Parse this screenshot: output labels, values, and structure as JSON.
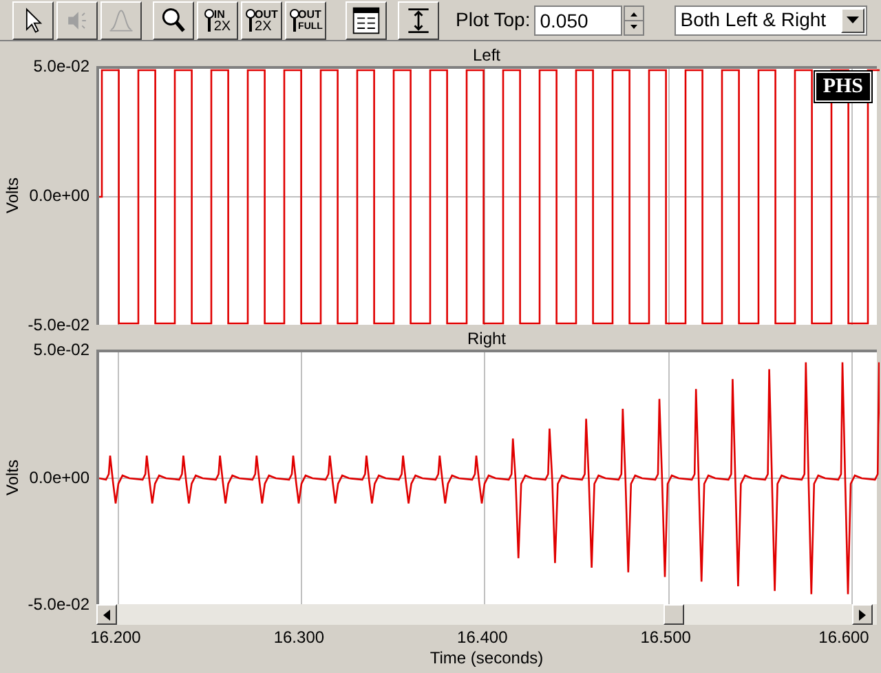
{
  "toolbar": {
    "groups": [
      {
        "buttons": [
          {
            "kind": "pointer",
            "disabled": false
          },
          {
            "kind": "speaker",
            "disabled": true
          },
          {
            "kind": "peak",
            "disabled": true
          }
        ]
      },
      {
        "buttons": [
          {
            "kind": "magnifier",
            "disabled": false
          },
          {
            "kind": "zoom",
            "top": "IN",
            "bottom": "2X",
            "disabled": false
          },
          {
            "kind": "zoom",
            "top": "OUT",
            "bottom": "2X",
            "disabled": false
          },
          {
            "kind": "zoom",
            "top": "OUT",
            "bottom": "FULL",
            "disabled": false
          }
        ]
      },
      {
        "buttons": [
          {
            "kind": "table",
            "disabled": false
          }
        ]
      },
      {
        "buttons": [
          {
            "kind": "fit",
            "disabled": false
          }
        ]
      }
    ],
    "plot_top": {
      "label": "Plot Top:",
      "value": "0.050"
    },
    "channel_select": {
      "value": "Both Left & Right"
    }
  },
  "plots": [
    {
      "title": "Left",
      "ylabel": "Volts",
      "yticks": [
        "5.0e-02",
        "0.0e+00",
        "-5.0e-02"
      ],
      "kind": "square",
      "badge": "PHS"
    },
    {
      "title": "Right",
      "ylabel": "Volts",
      "yticks": [
        "5.0e-02",
        "0.0e+00",
        "-5.0e-02"
      ],
      "kind": "spikes"
    }
  ],
  "x_axis": {
    "ticks": [
      "16.200",
      "16.300",
      "16.400",
      "16.500",
      "16.600"
    ],
    "label": "Time (seconds)"
  }
}
